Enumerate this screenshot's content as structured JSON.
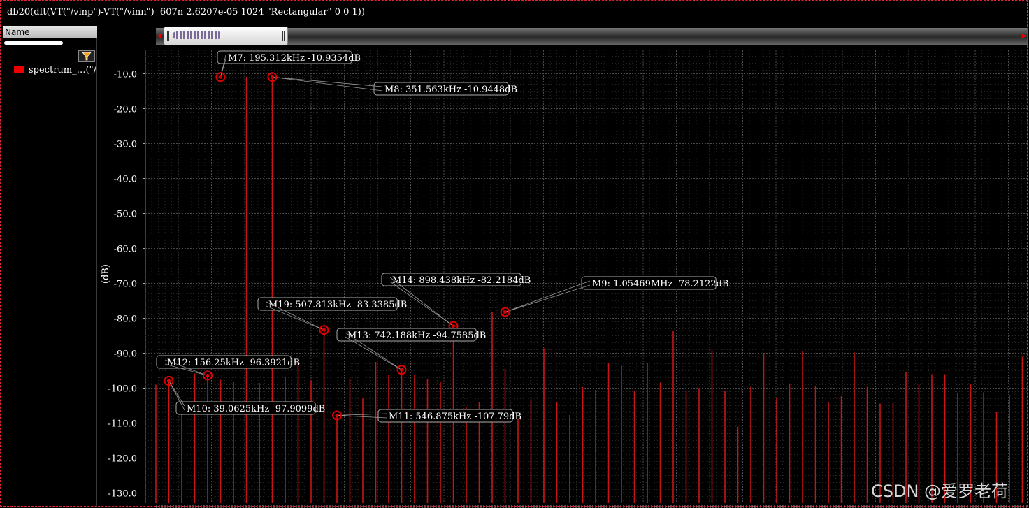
{
  "window": {
    "title": "db20(dft(VT(\"/vinp\")-VT(\"/vinn\")  607n 2.6207e-05 1024 \"Rectangular\" 0 0 1))",
    "watermark": "CSDN @爱罗老荷"
  },
  "legend": {
    "header": "Name",
    "entries": [
      {
        "label": "spectrum_…(\"/vi",
        "color": "#e00000"
      }
    ]
  },
  "colors": {
    "background": "#000000",
    "trace": "#c81414",
    "marker": "#e00000",
    "grid": "#2a2a2a"
  },
  "icons": {
    "filter": "funnel-icon",
    "scroll_left": "triangle-left-icon",
    "scroll_right": "triangle-right-icon"
  },
  "chart_data": {
    "type": "bar",
    "title": "",
    "xlabel": "",
    "ylabel": "(dB)",
    "ylim": [
      -133,
      -3
    ],
    "xlim_kHz": [
      0,
      1580
    ],
    "yticks": [
      "-10.0",
      "-20.0",
      "-30.0",
      "-40.0",
      "-50.0",
      "-60.0",
      "-70.0",
      "-80.0",
      "-90.0",
      "-100.0",
      "-110.0",
      "-120.0",
      "-130.0"
    ],
    "grid": true,
    "bin_spacing_kHz": 39.0625,
    "spectrum_dB": [
      -99.0,
      -97.9099,
      -103.8,
      -95.8,
      -96.3921,
      -97.6,
      -98.3,
      -10.9354,
      -98.5,
      -10.9448,
      -96.9,
      -91.6,
      -97.8,
      -83.3385,
      -107.79,
      -97.2,
      -102.8,
      -92.5,
      -96.1,
      -94.7585,
      -96.1,
      -97.5,
      -98.2,
      -82.2184,
      -105.4,
      -103.9,
      -78.2122,
      -94.5,
      -108.9,
      -103.2,
      -88.6,
      -103.9,
      -107.7,
      -99.7,
      -100.5,
      -92.7,
      -93.6,
      -100.8,
      -92.8,
      -98.4,
      -83.5,
      -100.8,
      -100.0,
      -89.2,
      -100.9,
      -111.1,
      -99.6,
      -89.9,
      -102.7,
      -98.8,
      -89.5,
      -99.5,
      -104.0,
      -102.3,
      -89.8,
      -99.6,
      -104.4,
      -104.2,
      -95.4,
      -99.0,
      -96.0,
      -96.0,
      -101.4,
      -98.9,
      -101.2,
      -106.9,
      -102.0,
      -91.0,
      -113.4,
      -94.7,
      -107.3,
      -101.0,
      -99.8,
      -103.0
    ],
    "markers": [
      {
        "name": "M7",
        "label": "M7: 195.312kHz -10.9354dB",
        "x_kHz": 195.312,
        "y_dB": -10.9354,
        "label_at": [
          311,
          82
        ]
      },
      {
        "name": "M8",
        "label": "M8: 351.563kHz -10.9448dB",
        "x_kHz": 351.563,
        "y_dB": -10.9448,
        "label_at": [
          535,
          127
        ]
      },
      {
        "name": "M19",
        "label": "M19: 507.813kHz -83.3385dB",
        "x_kHz": 507.813,
        "y_dB": -83.3385,
        "label_at": [
          369,
          435
        ]
      },
      {
        "name": "M14",
        "label": "M14: 898.438kHz -82.2184dB",
        "x_kHz": 898.438,
        "y_dB": -82.2184,
        "label_at": [
          546,
          400
        ]
      },
      {
        "name": "M9",
        "label": "M9: 1.05469MHz -78.2122dB",
        "x_kHz": 1054.69,
        "y_dB": -78.2122,
        "label_at": [
          832,
          405
        ]
      },
      {
        "name": "M13",
        "label": "M13: 742.188kHz -94.7585dB",
        "x_kHz": 742.188,
        "y_dB": -94.7585,
        "label_at": [
          482,
          479
        ]
      },
      {
        "name": "M12",
        "label": "M12: 156.25kHz -96.3921dB",
        "x_kHz": 156.25,
        "y_dB": -96.3921,
        "label_at": [
          224,
          518
        ]
      },
      {
        "name": "M10",
        "label": "M10: 39.0625kHz -97.9099dB",
        "x_kHz": 39.0625,
        "y_dB": -97.9099,
        "label_at": [
          252,
          584
        ]
      },
      {
        "name": "M11",
        "label": "M11: 546.875kHz -107.79dB",
        "x_kHz": 546.875,
        "y_dB": -107.79,
        "label_at": [
          541,
          595
        ]
      }
    ]
  }
}
